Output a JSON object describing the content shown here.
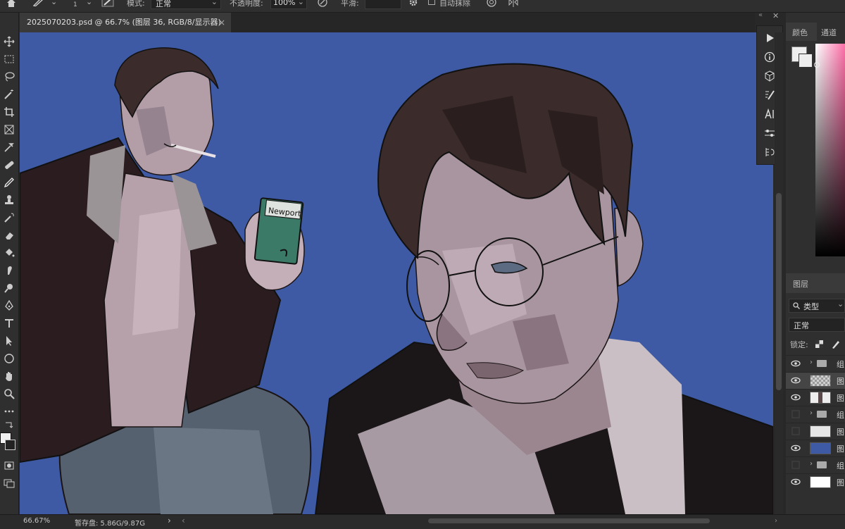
{
  "options_bar": {
    "mode_label": "模式:",
    "mode_value": "正常",
    "opacity_label": "不透明度:",
    "opacity_value": "100%",
    "smoothing_label": "平滑:",
    "auto_erase_label": "自动抹除",
    "brush_size": "1"
  },
  "document_tab": {
    "title": "2025070203.psd @ 66.7% (图层 36, RGB/8/显示器)",
    "close": "×"
  },
  "right_panel": {
    "color_tab": "颜色",
    "channels_tab": "通道",
    "layers_title": "图层",
    "search_kind": "类型",
    "blend_mode": "正常",
    "lock_label": "锁定:"
  },
  "layers": [
    {
      "kind": "group",
      "name": "组",
      "visible": true
    },
    {
      "kind": "layer",
      "name": "图",
      "visible": true,
      "thumb": "checker",
      "selected": true
    },
    {
      "kind": "layer",
      "name": "图",
      "visible": true,
      "thumb": "figure"
    },
    {
      "kind": "group",
      "name": "组",
      "visible": false
    },
    {
      "kind": "layer",
      "name": "图",
      "visible": false,
      "thumb": "light"
    },
    {
      "kind": "layer",
      "name": "图",
      "visible": true,
      "thumb": "blue"
    },
    {
      "kind": "group",
      "name": "组",
      "visible": false
    },
    {
      "kind": "layer",
      "name": "图",
      "visible": true,
      "thumb": "white"
    }
  ],
  "status_bar": {
    "zoom": "66.67%",
    "scratch": "暂存盘: 5.86G/9.87G",
    "arrow": "›"
  },
  "artwork": {
    "cigarette_box_brand": "Newport"
  },
  "colors": {
    "canvas_bg": "#3e5aa5",
    "ui_dark": "#2f2f2f",
    "jacket": "#2a1c1f",
    "hair": "#3b2b2a",
    "skin": "#b9a4ae",
    "box_green": "#3b7a66"
  },
  "icons": [
    "home-icon",
    "brush-icon",
    "eraser-icon",
    "pressure-icon",
    "symmetry-icon",
    "move-icon",
    "marquee-icon",
    "lasso-icon",
    "magic-wand-icon",
    "crop-icon",
    "frame-icon",
    "eyedropper-icon",
    "healing-icon",
    "pencil-icon",
    "stamp-icon",
    "history-brush-icon",
    "eraser-tool-icon",
    "bucket-icon",
    "smudge-icon",
    "dodge-icon",
    "pen-icon",
    "type-icon",
    "path-select-icon",
    "ellipse-icon",
    "hand-icon",
    "zoom-icon",
    "more-icon",
    "swap-icon",
    "color-swatch-icon",
    "quickmask-icon",
    "screen-mode-icon",
    "play-icon",
    "info-icon",
    "3d-icon",
    "brush-settings-icon",
    "character-icon",
    "adjust-icon",
    "history-icon",
    "eye-icon",
    "folder-icon",
    "lock-icon"
  ]
}
